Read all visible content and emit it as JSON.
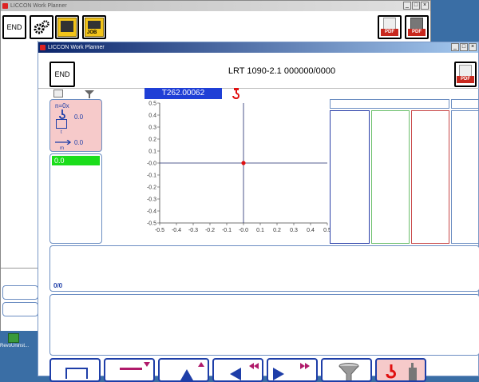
{
  "outer_window": {
    "title": "LICCON Work Planner",
    "controls": [
      "_",
      "□",
      "×"
    ],
    "toolbar": {
      "end_label": "END",
      "pdf_label_1": "PDF",
      "pdf_label_2": "PDF",
      "job_label": "JOB"
    }
  },
  "taskbar": {
    "label": "RevoUninst..."
  },
  "inner_window": {
    "title": "LICCON Work Planner",
    "controls": [
      "_",
      "□",
      "×"
    ],
    "end_label": "END",
    "crane_title": "LRT 1090-2.1  000000/0000",
    "pdf_label": "PDF",
    "load_id": "T262.00062",
    "status_panel": {
      "n_label": "n=0x",
      "hook_value": "0.0",
      "weight_unit": "t",
      "radius_value": "0.0",
      "radius_unit": "m"
    },
    "green_value": "0.0",
    "bottom_value": "0/0"
  },
  "chart_data": {
    "type": "scatter",
    "x": [
      0.0
    ],
    "y": [
      0.0
    ],
    "xlim": [
      -0.5,
      0.5
    ],
    "ylim": [
      -0.5,
      0.5
    ],
    "xticks": [
      "-0.5",
      "-0.4",
      "-0.3",
      "-0.2",
      "-0.1",
      "-0.0",
      "0.1",
      "0.2",
      "0.3",
      "0.4",
      "0.5"
    ],
    "yticks": [
      "0.5",
      "0.4",
      "0.3",
      "0.2",
      "0.1",
      "-0.0",
      "-0.1",
      "-0.2",
      "-0.3",
      "-0.4",
      "-0.5"
    ],
    "point_color": "#e01010",
    "axis_color": "#1e2a6e"
  }
}
